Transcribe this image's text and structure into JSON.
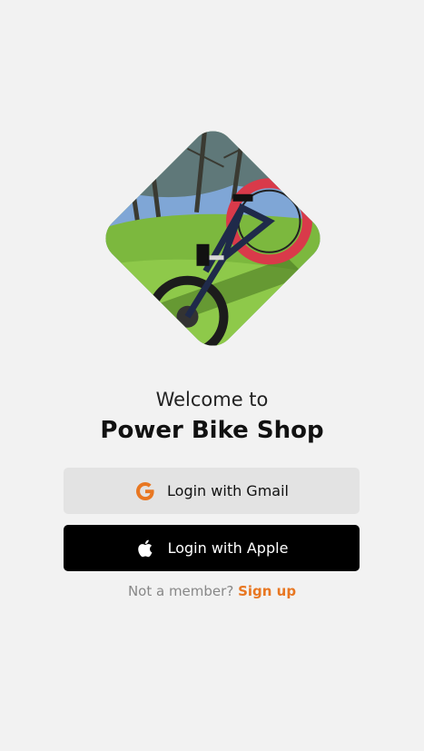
{
  "hero": {
    "image_alt": "Bike photo",
    "subject": "electric fat bike on grass"
  },
  "heading": {
    "welcome": "Welcome to",
    "shop_name": "Power Bike Shop"
  },
  "buttons": {
    "gmail": {
      "label": "Login with Gmail",
      "icon": "google-icon"
    },
    "apple": {
      "label": "Login with Apple",
      "icon": "apple-icon"
    }
  },
  "signup": {
    "prompt": "Not a member?",
    "link": "Sign up"
  },
  "colors": {
    "background": "#f2f2f2",
    "accent": "#e87722",
    "gmail_button": "#e3e3e3",
    "apple_button": "#000000"
  }
}
